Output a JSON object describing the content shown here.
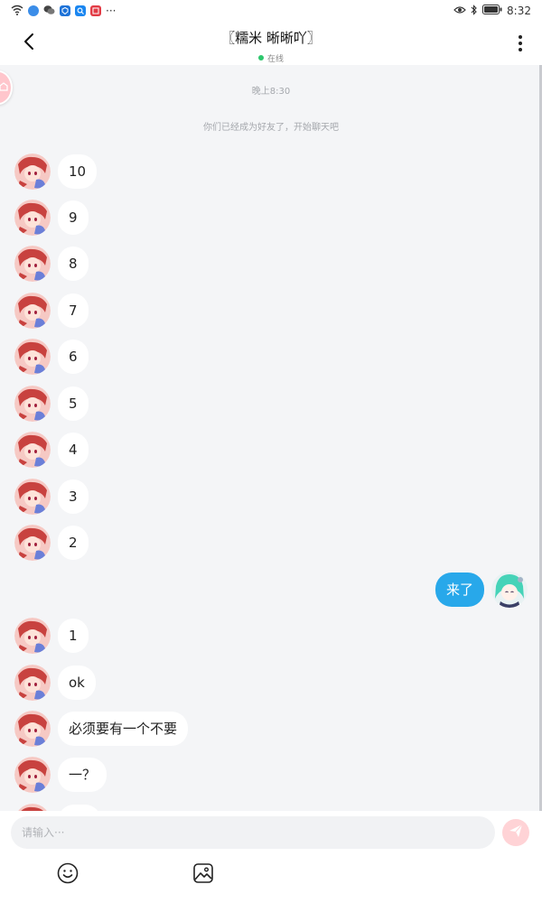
{
  "status_bar": {
    "time": "8:32",
    "more_indicator": "···",
    "left_icons": [
      "wifi-icon",
      "browser-icon",
      "wechat-icon",
      "app-icon",
      "search-app-icon",
      "news-app-icon"
    ],
    "right_icons": [
      "eye-icon",
      "bluetooth-icon",
      "battery-icon"
    ]
  },
  "header": {
    "title": "〖糯米 晰晰吖〗",
    "status": "在线",
    "status_color": "#2dc76d"
  },
  "chat": {
    "time_divider": "晚上8:30",
    "system_note": "你们已经成为好友了，开始聊天吧",
    "messages": [
      {
        "side": "left",
        "text": "10"
      },
      {
        "side": "left",
        "text": "9"
      },
      {
        "side": "left",
        "text": "8"
      },
      {
        "side": "left",
        "text": "7"
      },
      {
        "side": "left",
        "text": "6"
      },
      {
        "side": "left",
        "text": "5"
      },
      {
        "side": "left",
        "text": "4"
      },
      {
        "side": "left",
        "text": "3"
      },
      {
        "side": "left",
        "text": "2"
      },
      {
        "side": "right",
        "text": "来了"
      },
      {
        "side": "left",
        "text": "1"
      },
      {
        "side": "left",
        "text": "ok"
      },
      {
        "side": "left",
        "text": "必须要有一个不要"
      },
      {
        "side": "left",
        "text": "一？"
      }
    ]
  },
  "composer": {
    "placeholder": "请输入···",
    "tools": [
      "emoji-icon",
      "image-icon"
    ]
  },
  "colors": {
    "accent": "#28a8ea",
    "send_button": "#ffd3d6",
    "background": "#f4f5f7"
  }
}
